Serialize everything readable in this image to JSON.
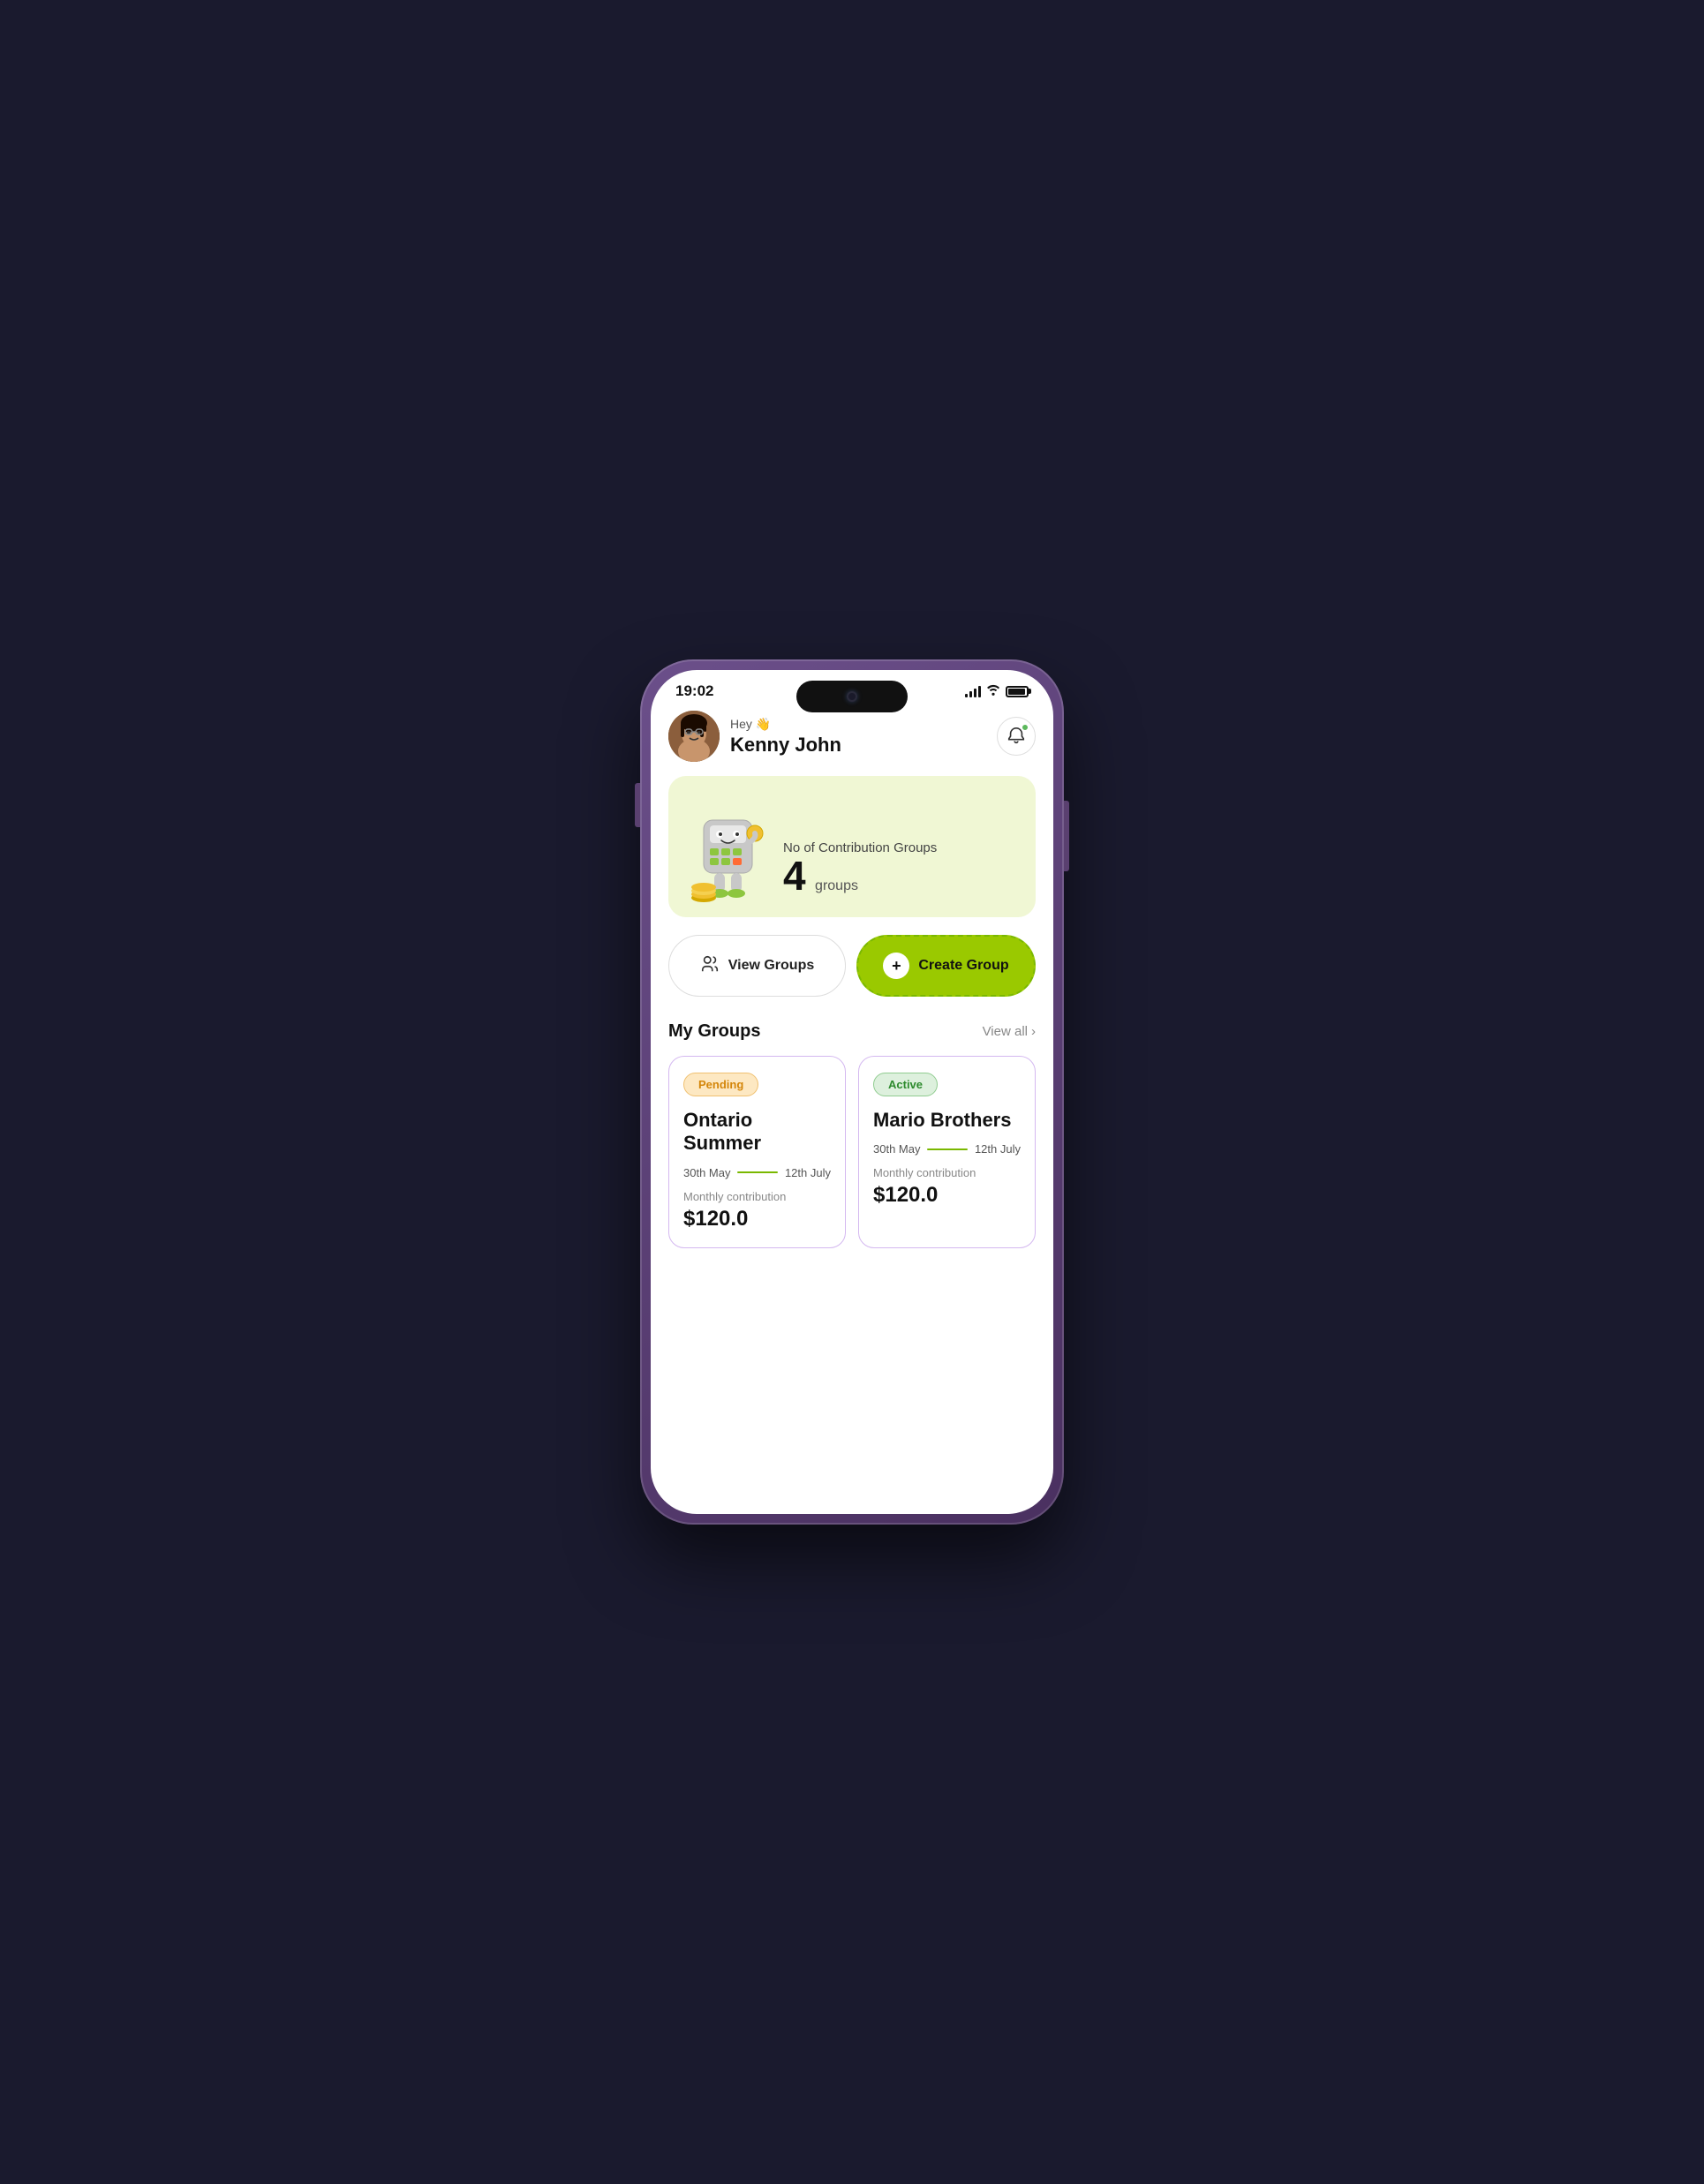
{
  "phone": {
    "status_bar": {
      "time": "19:02"
    },
    "header": {
      "greeting": "Hey 👋",
      "user_name": "Kenny John",
      "notification_has_dot": true
    },
    "banner": {
      "label": "No of Contribution Groups",
      "count": "4",
      "count_label": "groups"
    },
    "buttons": {
      "view_groups": "View Groups",
      "create_group": "Create Group"
    },
    "my_groups": {
      "title": "My Groups",
      "view_all": "View all",
      "cards": [
        {
          "status": "Pending",
          "status_type": "pending",
          "name": "Ontario Summer",
          "date_start": "30th May",
          "date_end": "12th July",
          "contribution_label": "Monthly contribution",
          "amount": "$120.0"
        },
        {
          "status": "Active",
          "status_type": "active",
          "name": "Mario Brothers",
          "date_start": "30th May",
          "date_end": "12th July",
          "contribution_label": "Monthly contribution",
          "amount": "$120.0"
        }
      ]
    }
  }
}
